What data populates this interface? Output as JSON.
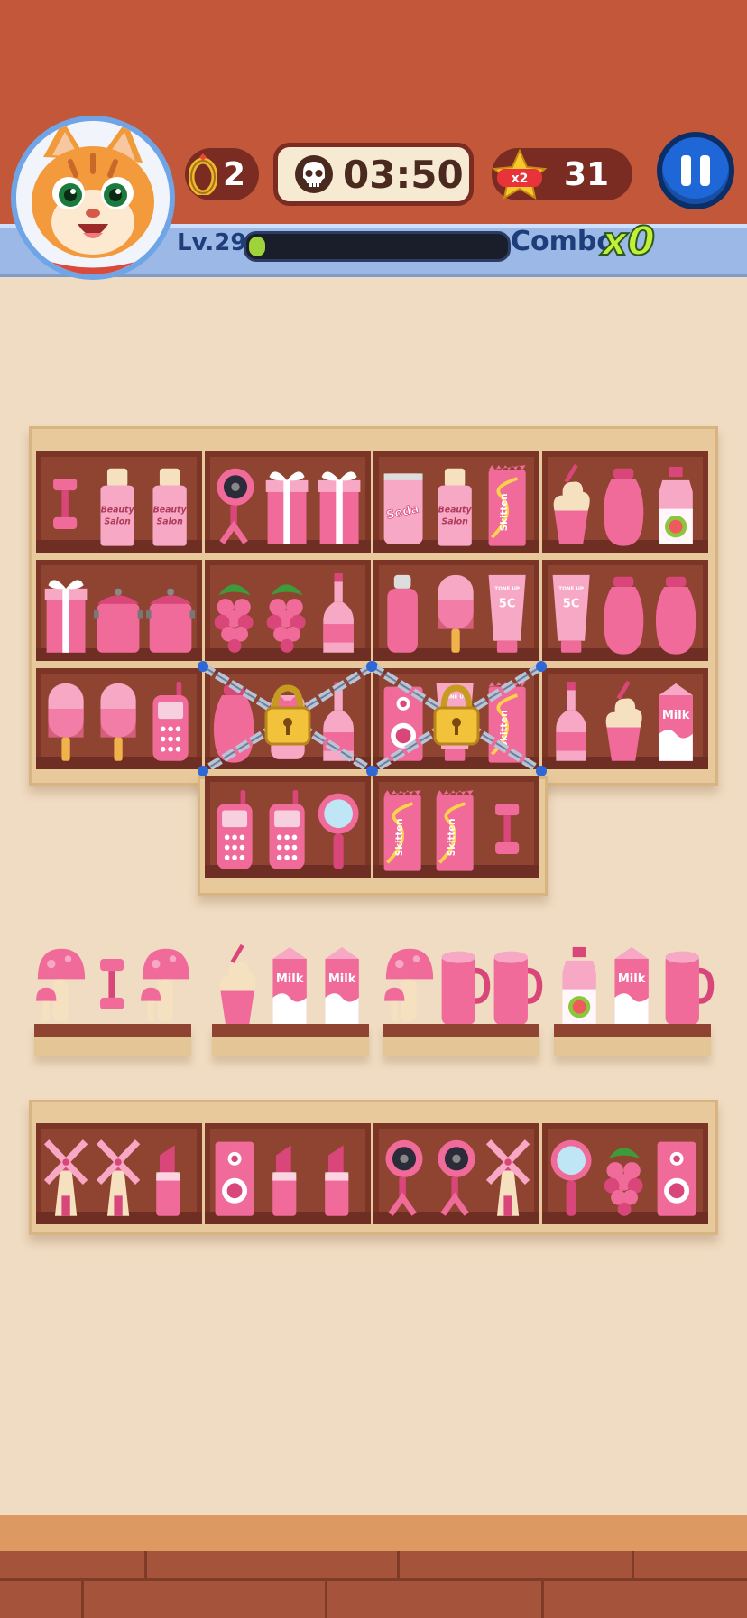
{
  "hud": {
    "rings": "2",
    "timer": "03:50",
    "star_multiplier": "x2",
    "stars": "31",
    "level": "Lv.29",
    "progress_fraction": 0.05,
    "combo_label": "Combo",
    "combo_value": "x0"
  },
  "labels": {
    "beauty_salon": "Beauty Salon",
    "soda": "Soda",
    "skitten": "Skitten",
    "tone_up": "TONE UP",
    "fifty_c": "5C",
    "milk": "Milk"
  },
  "colors": {
    "pink": "#f06b9a",
    "pink_light": "#f7a8c4",
    "pink_dark": "#d9467a",
    "cream": "#f5e1c0",
    "header": "#c2573a",
    "background": "#f0dcc2"
  },
  "grid": {
    "rows": [
      [
        [
          "dumbbell",
          "beauty-salon-bottle",
          "beauty-salon-bottle"
        ],
        [
          "desk-fan",
          "gift-box",
          "gift-box"
        ],
        [
          "soda-can",
          "beauty-salon-bottle",
          "skitten-candy"
        ],
        [
          "cupcake",
          "vase",
          "guava-juice"
        ]
      ],
      [
        [
          "gift-box",
          "cooking-pot",
          "cooking-pot"
        ],
        [
          "grapes",
          "grapes",
          "wine-bottle"
        ],
        [
          "water-bottle",
          "popsicle",
          "tone-up-tube"
        ],
        [
          "tone-up-tube",
          "vase",
          "vase"
        ]
      ],
      [
        [
          "popsicle",
          "popsicle",
          "cell-phone"
        ],
        [
          "vase",
          "teddy-jar",
          "wine-bottle"
        ],
        [
          "speaker",
          "tone-up-tube",
          "skitten-candy"
        ],
        [
          "wine-bottle",
          "cupcake",
          "milk-carton"
        ]
      ],
      [
        null,
        [
          "cell-phone",
          "cell-phone",
          "hand-mirror"
        ],
        [
          "skitten-candy",
          "skitten-candy",
          "dumbbell"
        ],
        null
      ]
    ],
    "locked_cells": [
      [
        2,
        1
      ],
      [
        2,
        2
      ]
    ],
    "open_shelves": [
      [
        "mushroom",
        "dumbbell",
        "mushroom"
      ],
      [
        "cupcake",
        "milk-carton",
        "milk-carton"
      ],
      [
        "mushroom",
        "mug",
        "mug"
      ],
      [
        "guava-juice",
        "milk-carton",
        "mug"
      ]
    ],
    "bottom_row": [
      [
        "windmill",
        "windmill",
        "lipstick"
      ],
      [
        "speaker",
        "lipstick",
        "lipstick"
      ],
      [
        "desk-fan",
        "desk-fan",
        "windmill"
      ],
      [
        "hand-mirror",
        "grapes",
        "speaker"
      ]
    ]
  }
}
